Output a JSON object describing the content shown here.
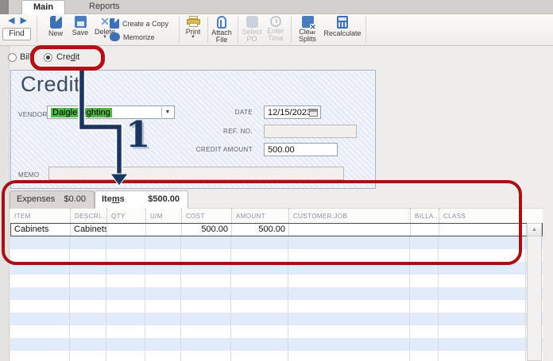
{
  "window_tabs": {
    "main": "Main",
    "reports": "Reports"
  },
  "toolbar": {
    "find": "Find",
    "new": "New",
    "save": "Save",
    "delete": "Delete",
    "create_a_copy": "Create a Copy",
    "memorize": "Memorize",
    "print": "Print",
    "attach_file": "Attach File",
    "select_po": "Select PO",
    "enter_time": "Enter Time",
    "clear_splits": "Clear Splits",
    "recalculate": "Recalculate"
  },
  "doc_type": {
    "bill_label": "Bill",
    "credit_pre": "Cre",
    "credit_accel": "d",
    "credit_post": "it",
    "selected": "credit"
  },
  "form": {
    "title": "Credit",
    "vendor_label": "VENDOR",
    "vendor_value": "Daigle Lighting",
    "date_label": "DATE",
    "date_value": "12/15/2023",
    "ref_label": "REF. NO.",
    "ref_value": "",
    "credit_amount_label": "CREDIT AMOUNT",
    "credit_amount_value": "500.00",
    "memo_label": "MEMO",
    "memo_value": ""
  },
  "detail_tabs": {
    "expenses_label": "Expenses",
    "expenses_amount": "$0.00",
    "items_pre": "Ite",
    "items_accel": "m",
    "items_post": "s",
    "items_amount": "$500.00",
    "active": "items"
  },
  "items_table": {
    "columns": [
      "ITEM",
      "DESCRI...",
      "QTY",
      "U/M",
      "COST",
      "AMOUNT",
      "CUSTOMER:JOB",
      "BILLA...",
      "CLASS"
    ],
    "rows": [
      [
        "Cabinets",
        "Cabinets",
        "",
        "",
        "500.00",
        "500.00",
        "",
        "",
        ""
      ]
    ]
  },
  "annotation": {
    "step_number": "1",
    "accent_red": "#a61114",
    "arrow_navy": "#1b355f"
  }
}
